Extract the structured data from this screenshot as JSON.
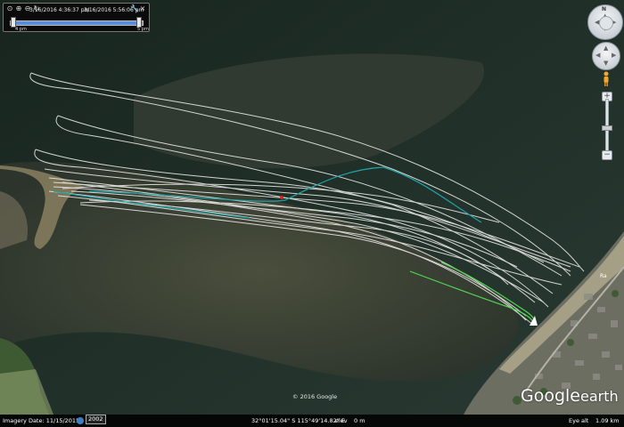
{
  "time_slider": {
    "start_time": "3/16/2016  4:36:37 pm",
    "end_time": "3/16/2016  5:56:06 pm",
    "label_left": "4 pm",
    "label_right": "5 pm"
  },
  "navigation": {
    "north_label": "N"
  },
  "map": {
    "copyright": "© 2016 Google",
    "logo_google": "Google",
    "logo_earth": "earth",
    "road_label": "Ra"
  },
  "status_bar": {
    "imagery_date": "Imagery Date: 11/15/2015",
    "historical_year": "2002",
    "coordinates": "32°01'15.04\" S  115°49'14.82\" E",
    "elev_label": "elev",
    "elev_value": "0 m",
    "eye_alt": "Eye alt",
    "eye_alt_value": "1.09 km"
  },
  "colors": {
    "track_white": "#e6e6e2",
    "track_teal": "#1fa3a8",
    "track_green": "#4fd84f"
  }
}
